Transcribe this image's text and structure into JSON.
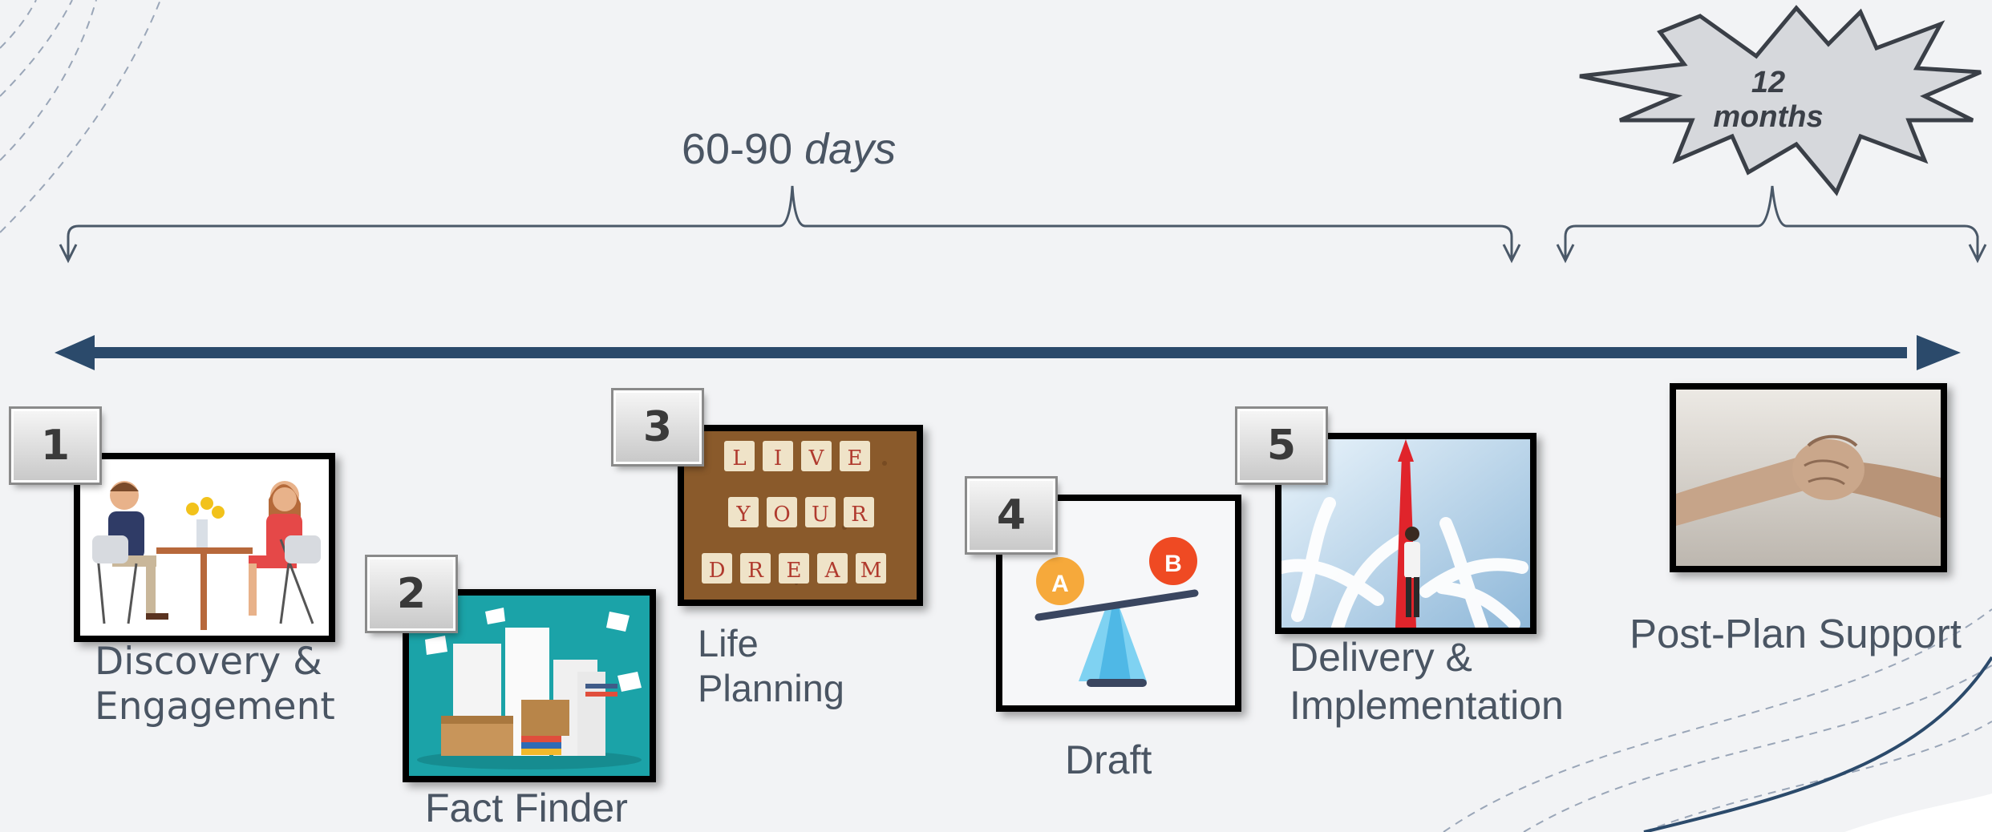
{
  "timeline": {
    "span_number": "60-90",
    "span_unit": "days",
    "burst_line1": "12",
    "burst_line2": "months"
  },
  "steps": [
    {
      "number": "1",
      "label_line1": "Discovery &",
      "label_line2": "Engagement"
    },
    {
      "number": "2",
      "label_line1": "Fact Finder",
      "label_line2": ""
    },
    {
      "number": "3",
      "label_line1": "Life",
      "label_line2": "Planning"
    },
    {
      "number": "4",
      "label_line1": "Draft",
      "label_line2": ""
    },
    {
      "number": "5",
      "label_line1": "Delivery &",
      "label_line2": "Implementation"
    }
  ],
  "post_plan": {
    "label": "Post-Plan Support"
  },
  "tiles": {
    "row1": [
      "L",
      "I",
      "V",
      "E"
    ],
    "row2": [
      "Y",
      "O",
      "U",
      "R"
    ],
    "row3": [
      "D",
      "R",
      "E",
      "A",
      "M"
    ]
  },
  "scale_options": [
    "A",
    "B"
  ],
  "colors": {
    "arrow": "#2b4a6b",
    "brace": "#4a5868",
    "teal": "#1ba3a8",
    "cork": "#8a5a2b"
  }
}
